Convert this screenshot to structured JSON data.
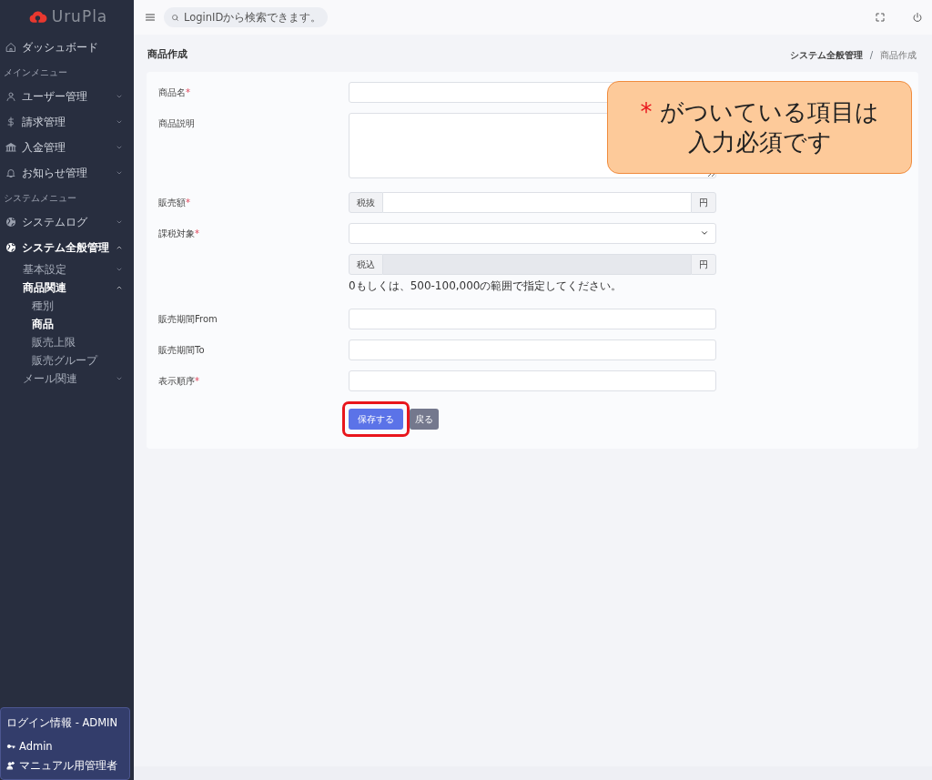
{
  "sidebar": {
    "logo": "UruPla",
    "items": [
      {
        "kind": "link",
        "label": "ダッシュボード",
        "selected": false
      },
      {
        "kind": "heading",
        "label": "メインメニュー"
      },
      {
        "kind": "link",
        "label": "ユーザー管理",
        "selected": false,
        "expanded": false
      },
      {
        "kind": "link",
        "label": "請求管理",
        "selected": false,
        "expanded": false
      },
      {
        "kind": "link",
        "label": "入金管理",
        "selected": false,
        "expanded": false
      },
      {
        "kind": "link",
        "label": "お知らせ管理",
        "selected": false,
        "expanded": false
      },
      {
        "kind": "heading",
        "label": "システムメニュー"
      },
      {
        "kind": "link",
        "label": "システムログ",
        "selected": false,
        "expanded": false
      },
      {
        "kind": "link",
        "label": "システム全般管理",
        "selected": true,
        "expanded": true,
        "children": [
          {
            "label": "基本設定",
            "selected": false,
            "expanded": false
          },
          {
            "label": "商品関連",
            "selected": true,
            "expanded": true,
            "children": [
              {
                "label": "種別",
                "selected": false
              },
              {
                "label": "商品",
                "selected": true
              },
              {
                "label": "販売上限",
                "selected": false
              },
              {
                "label": "販売グループ",
                "selected": false
              }
            ]
          },
          {
            "label": "メール関連",
            "selected": false,
            "expanded": false
          }
        ]
      }
    ],
    "login_info": {
      "title": "ログイン情報 - ADMIN",
      "user": "Admin",
      "role": "マニュアル用管理者"
    }
  },
  "topbar": {
    "search": {
      "placeholder": "LoginIDから検索できます。"
    }
  },
  "page": {
    "title": "商品作成",
    "breadcrumb_separator": "/",
    "breadcrumb": [
      {
        "label": "システム全般管理",
        "selected": false
      },
      {
        "label": "商品作成",
        "selected": true
      }
    ]
  },
  "form": {
    "fields": [
      {
        "kind": "text",
        "label": "商品名",
        "required_mark": "*"
      },
      {
        "kind": "textarea",
        "label": "商品説明"
      },
      {
        "kind": "group",
        "label": "販売額",
        "required_mark": "*",
        "prefix": "税抜",
        "suffix": "円",
        "disabled": false
      },
      {
        "kind": "select",
        "label": "課税対象",
        "required_mark": "*"
      },
      {
        "kind": "group",
        "prefix": "税込",
        "suffix": "円",
        "disabled": true,
        "help": "0もしくは、500-100,000の範囲で指定してください。"
      },
      {
        "kind": "text",
        "label": "販売期間From"
      },
      {
        "kind": "text",
        "label": "販売期間To"
      },
      {
        "kind": "text",
        "label": "表示順序",
        "required_mark": "*"
      }
    ],
    "buttons": [
      {
        "label": "保存する",
        "kind": "primary",
        "highlighted": true
      },
      {
        "label": "戻る",
        "kind": "secondary",
        "highlighted": false
      }
    ]
  },
  "callout": {
    "mark": "*",
    "lines": [
      "がついている項目は",
      "入力必須です"
    ]
  }
}
